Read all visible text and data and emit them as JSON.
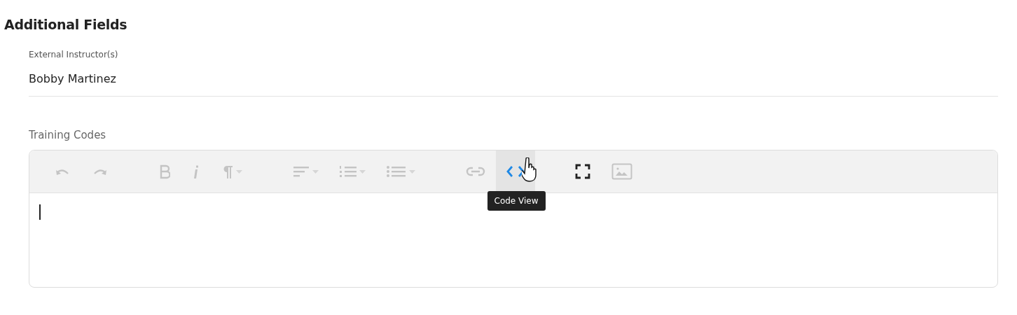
{
  "section_title": "Additional Fields",
  "fields": [
    {
      "label": "External Instructor(s)",
      "value": "Bobby Martinez"
    }
  ],
  "editor": {
    "label": "Training Codes",
    "toolbar": [
      [
        {
          "kind": "undo",
          "disabled": true,
          "hovered": false,
          "dropdown": false
        },
        {
          "kind": "redo",
          "disabled": true,
          "hovered": false,
          "dropdown": false
        }
      ],
      [
        {
          "kind": "bold",
          "disabled": true,
          "hovered": false,
          "dropdown": false
        },
        {
          "kind": "italic",
          "disabled": true,
          "hovered": false,
          "dropdown": false
        },
        {
          "kind": "paragraph",
          "disabled": true,
          "hovered": false,
          "dropdown": true
        }
      ],
      [
        {
          "kind": "align",
          "disabled": true,
          "hovered": false,
          "dropdown": true
        },
        {
          "kind": "ordered-list",
          "disabled": true,
          "hovered": false,
          "dropdown": true
        },
        {
          "kind": "bullet-list",
          "disabled": true,
          "hovered": false,
          "dropdown": true
        }
      ],
      [
        {
          "kind": "link",
          "disabled": true,
          "hovered": false,
          "dropdown": false
        },
        {
          "kind": "code",
          "disabled": false,
          "hovered": true,
          "dropdown": false
        }
      ],
      [
        {
          "kind": "fullscreen",
          "disabled": false,
          "hovered": false,
          "dropdown": false
        },
        {
          "kind": "image",
          "disabled": true,
          "hovered": false,
          "dropdown": false
        }
      ]
    ],
    "tooltip": "Code View"
  }
}
